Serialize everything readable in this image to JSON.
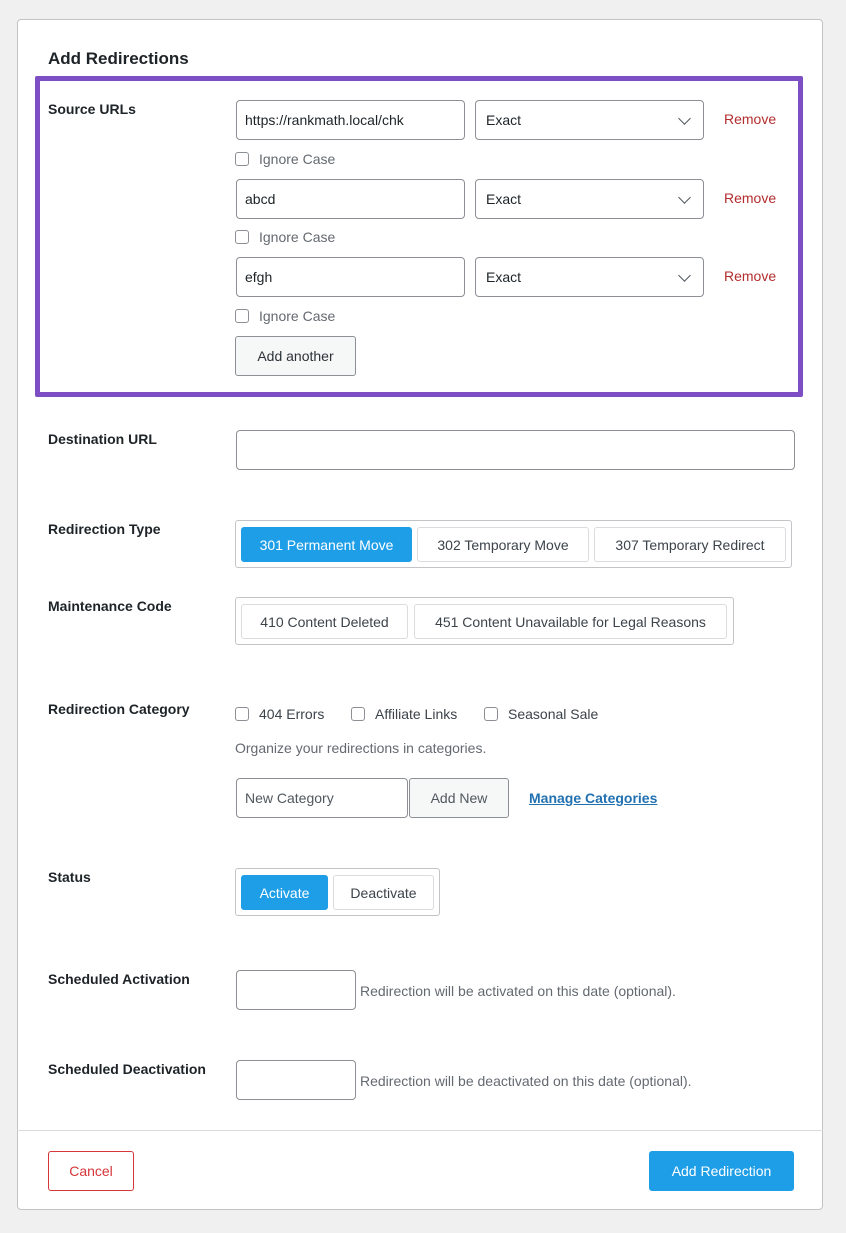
{
  "form": {
    "title": "Add Redirections"
  },
  "source_urls": {
    "label": "Source URLs",
    "items": [
      {
        "url": "https://rankmath.local/chk",
        "match": "Exact",
        "remove_label": "Remove",
        "ignore_case_label": "Ignore Case",
        "ignore_case_checked": false
      },
      {
        "url": "abcd",
        "match": "Exact",
        "remove_label": "Remove",
        "ignore_case_label": "Ignore Case",
        "ignore_case_checked": false
      },
      {
        "url": "efgh",
        "match": "Exact",
        "remove_label": "Remove",
        "ignore_case_label": "Ignore Case",
        "ignore_case_checked": false
      }
    ],
    "add_another_label": "Add another"
  },
  "destination": {
    "label": "Destination URL",
    "value": ""
  },
  "redirection_type": {
    "label": "Redirection Type",
    "options": [
      "301 Permanent Move",
      "302 Temporary Move",
      "307 Temporary Redirect"
    ],
    "selected": "301 Permanent Move"
  },
  "maintenance_code": {
    "label": "Maintenance Code",
    "options": [
      "410 Content Deleted",
      "451 Content Unavailable for Legal Reasons"
    ]
  },
  "category": {
    "label": "Redirection Category",
    "options": [
      "404 Errors",
      "Affiliate Links",
      "Seasonal Sale"
    ],
    "help": "Organize your redirections in categories.",
    "new_placeholder": "New Category",
    "add_new_label": "Add New",
    "manage_label": "Manage Categories"
  },
  "status": {
    "label": "Status",
    "options": [
      "Activate",
      "Deactivate"
    ],
    "selected": "Activate"
  },
  "scheduled_activation": {
    "label": "Scheduled Activation",
    "help": "Redirection will be activated on this date (optional)."
  },
  "scheduled_deactivation": {
    "label": "Scheduled Deactivation",
    "help": "Redirection will be deactivated on this date (optional)."
  },
  "footer": {
    "cancel_label": "Cancel",
    "submit_label": "Add Redirection"
  },
  "colors": {
    "accent": "#1f9ee8",
    "highlight": "#7e4fc4",
    "danger": "#d63638",
    "remove": "#b32d2e"
  }
}
